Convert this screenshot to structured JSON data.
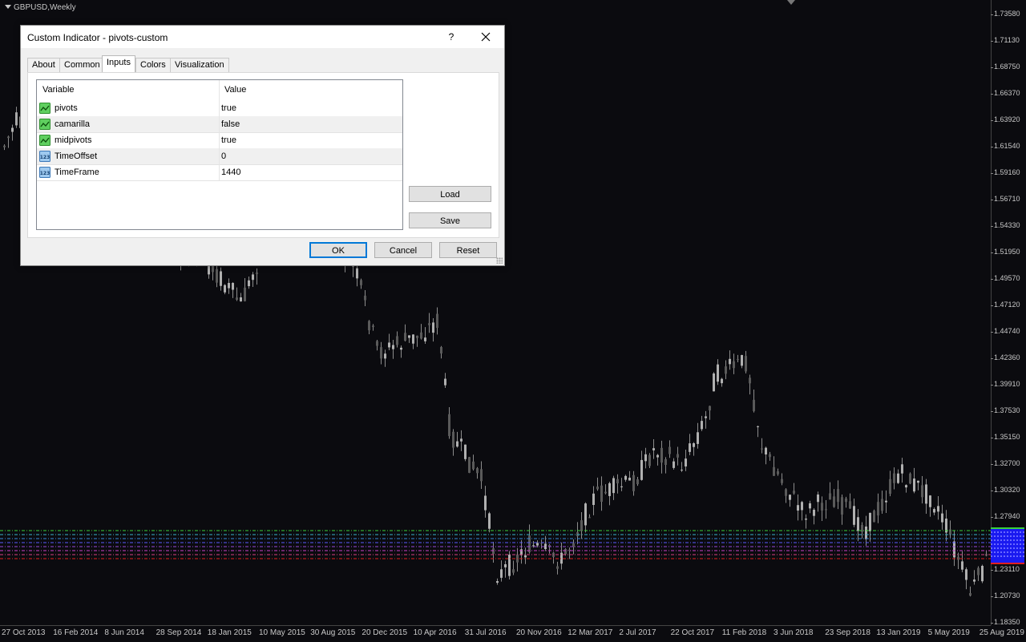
{
  "chart": {
    "symbol": "GBPUSD,Weekly",
    "price_ticks": [
      "1.73580",
      "1.71130",
      "1.68750",
      "1.66370",
      "1.63920",
      "1.61540",
      "1.59160",
      "1.56710",
      "1.54330",
      "1.51950",
      "1.49570",
      "1.47120",
      "1.44740",
      "1.42360",
      "1.39910",
      "1.37530",
      "1.35150",
      "1.32700",
      "1.30320",
      "1.27940",
      "1.23110",
      "1.20730",
      "1.18350"
    ],
    "time_ticks": [
      "27 Oct 2013",
      "16 Feb 2014",
      "8 Jun 2014",
      "28 Sep 2014",
      "18 Jan 2015",
      "10 May 2015",
      "30 Aug 2015",
      "20 Dec 2015",
      "10 Apr 2016",
      "31 Jul 2016",
      "20 Nov 2016",
      "12 Mar 2017",
      "2 Jul 2017",
      "22 Oct 2017",
      "11 Feb 2018",
      "3 Jun 2018",
      "23 Sep 2018",
      "13 Jan 2019",
      "5 May 2019",
      "25 Aug 2019"
    ],
    "colors": {
      "background": "#0b0b0f",
      "candle": "#8c8c8c",
      "text": "#c8c8c8",
      "current_price_box": "#1a1af0"
    }
  },
  "dialog": {
    "title": "Custom Indicator - pivots-custom",
    "help_label": "?",
    "tabs": [
      {
        "label": "About"
      },
      {
        "label": "Common"
      },
      {
        "label": "Inputs",
        "active": true
      },
      {
        "label": "Colors"
      },
      {
        "label": "Visualization"
      }
    ],
    "table": {
      "columns": [
        "Variable",
        "Value"
      ],
      "rows": [
        {
          "variable": "pivots",
          "value": "true",
          "icon": "bool-icon"
        },
        {
          "variable": "camarilla",
          "value": "false",
          "icon": "bool-icon"
        },
        {
          "variable": "midpivots",
          "value": "true",
          "icon": "bool-icon"
        },
        {
          "variable": "TimeOffset",
          "value": "0",
          "icon": "integer-icon"
        },
        {
          "variable": "TimeFrame",
          "value": "1440",
          "icon": "integer-icon"
        }
      ]
    },
    "buttons": {
      "load": "Load",
      "save": "Save",
      "ok": "OK",
      "cancel": "Cancel",
      "reset": "Reset"
    }
  }
}
